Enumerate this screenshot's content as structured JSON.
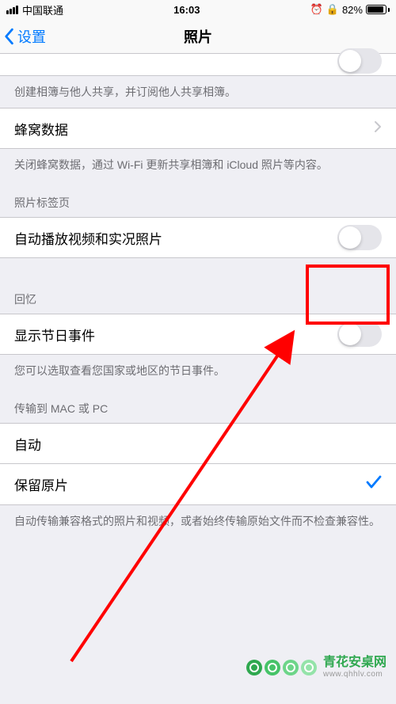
{
  "status_bar": {
    "carrier": "中国联通",
    "time": "16:03",
    "battery_percent": "82%"
  },
  "nav": {
    "back_label": "设置",
    "title": "照片"
  },
  "shared_albums": {
    "footer": "创建相簿与他人共享，并订阅他人共享相簿。"
  },
  "cellular": {
    "label": "蜂窝数据",
    "footer": "关闭蜂窝数据，通过 Wi-Fi 更新共享相簿和 iCloud 照片等内容。"
  },
  "photos_tab": {
    "header": "照片标签页",
    "autoplay_label": "自动播放视频和实况照片",
    "autoplay_on": false
  },
  "memories": {
    "header": "回忆",
    "show_holidays_label": "显示节日事件",
    "show_holidays_on": false,
    "footer": "您可以选取查看您国家或地区的节日事件。"
  },
  "transfer": {
    "header": "传输到 MAC 或 PC",
    "auto_label": "自动",
    "keep_original_label": "保留原片",
    "selected": "keep_original",
    "footer": "自动传输兼容格式的照片和视频，或者始终传输原始文件而不检查兼容性。"
  },
  "watermark": {
    "title": "青花安桌网",
    "sub": "www.qhhlv.com"
  }
}
